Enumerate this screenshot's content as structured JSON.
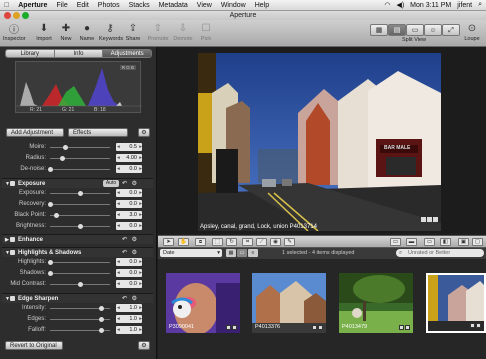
{
  "menubar": {
    "items": [
      "Aperture",
      "File",
      "Edit",
      "Photos",
      "Stacks",
      "Metadata",
      "View",
      "Window",
      "Help"
    ],
    "clock": "Mon 3:11 PM",
    "user": "jifent"
  },
  "window": {
    "title": "Aperture"
  },
  "toolbar": {
    "left": [
      "Inspector",
      "Import",
      "New",
      "Name",
      "Keywords",
      "Share",
      "Promote",
      "Demote",
      "Pick"
    ],
    "view_label": "Split View",
    "loupe": "Loupe"
  },
  "inspector": {
    "tabs": [
      "Library",
      "Info",
      "Adjustments"
    ],
    "active_tab": "Adjustments",
    "histogram": {
      "rgb_label": "R G B",
      "readout": {
        "r": "R: 21",
        "g": "G: 21",
        "b": "B: 18"
      }
    },
    "add_adjustment": "Add Adjustment",
    "effects": "Effects",
    "top_sliders": [
      {
        "label": "Moire:",
        "value": "0.5",
        "level": 0.25
      },
      {
        "label": "Radius:",
        "value": "4.00",
        "level": 0.2
      },
      {
        "label": "De-noise:",
        "value": "0.0",
        "level": 0.0
      }
    ],
    "exposure": {
      "title": "Exposure",
      "auto": "Auto",
      "sliders": [
        {
          "label": "Exposure:",
          "value": "0.0",
          "level": 0.5
        },
        {
          "label": "Recovery:",
          "value": "0.0",
          "level": 0.0
        },
        {
          "label": "Black Point:",
          "value": "3.0",
          "level": 0.1
        },
        {
          "label": "Brightness:",
          "value": "0.0",
          "level": 0.5
        }
      ]
    },
    "enhance": {
      "title": "Enhance"
    },
    "highlights": {
      "title": "Highlights & Shadows",
      "sliders": [
        {
          "label": "Highlights:",
          "value": "0.0",
          "level": 0.0
        },
        {
          "label": "Shadows:",
          "value": "0.0",
          "level": 0.0
        },
        {
          "label": "Mid Contrast:",
          "value": "0.0",
          "level": 0.5
        }
      ]
    },
    "edge": {
      "title": "Edge Sharpen",
      "sliders": [
        {
          "label": "Intensity:",
          "value": "1.0",
          "level": 0.85
        },
        {
          "label": "Edges:",
          "value": "1.0",
          "level": 0.85
        },
        {
          "label": "Falloff:",
          "value": "1.0",
          "level": 0.85
        }
      ]
    },
    "revert": "Revert to Original"
  },
  "viewer": {
    "caption": "Apsley, canal, grand, Lock, union  P4013714",
    "shop_sign": "BAR MALE"
  },
  "browser": {
    "sort": "Date",
    "status": "1 selected - 4 items displayed",
    "rating_filter": "Unrated or Better"
  },
  "thumbnails": [
    "P3090041",
    "P4013376",
    "P4013479",
    ""
  ],
  "colors": {
    "selection": "#ffffff",
    "accent": "#3b6fd0"
  }
}
